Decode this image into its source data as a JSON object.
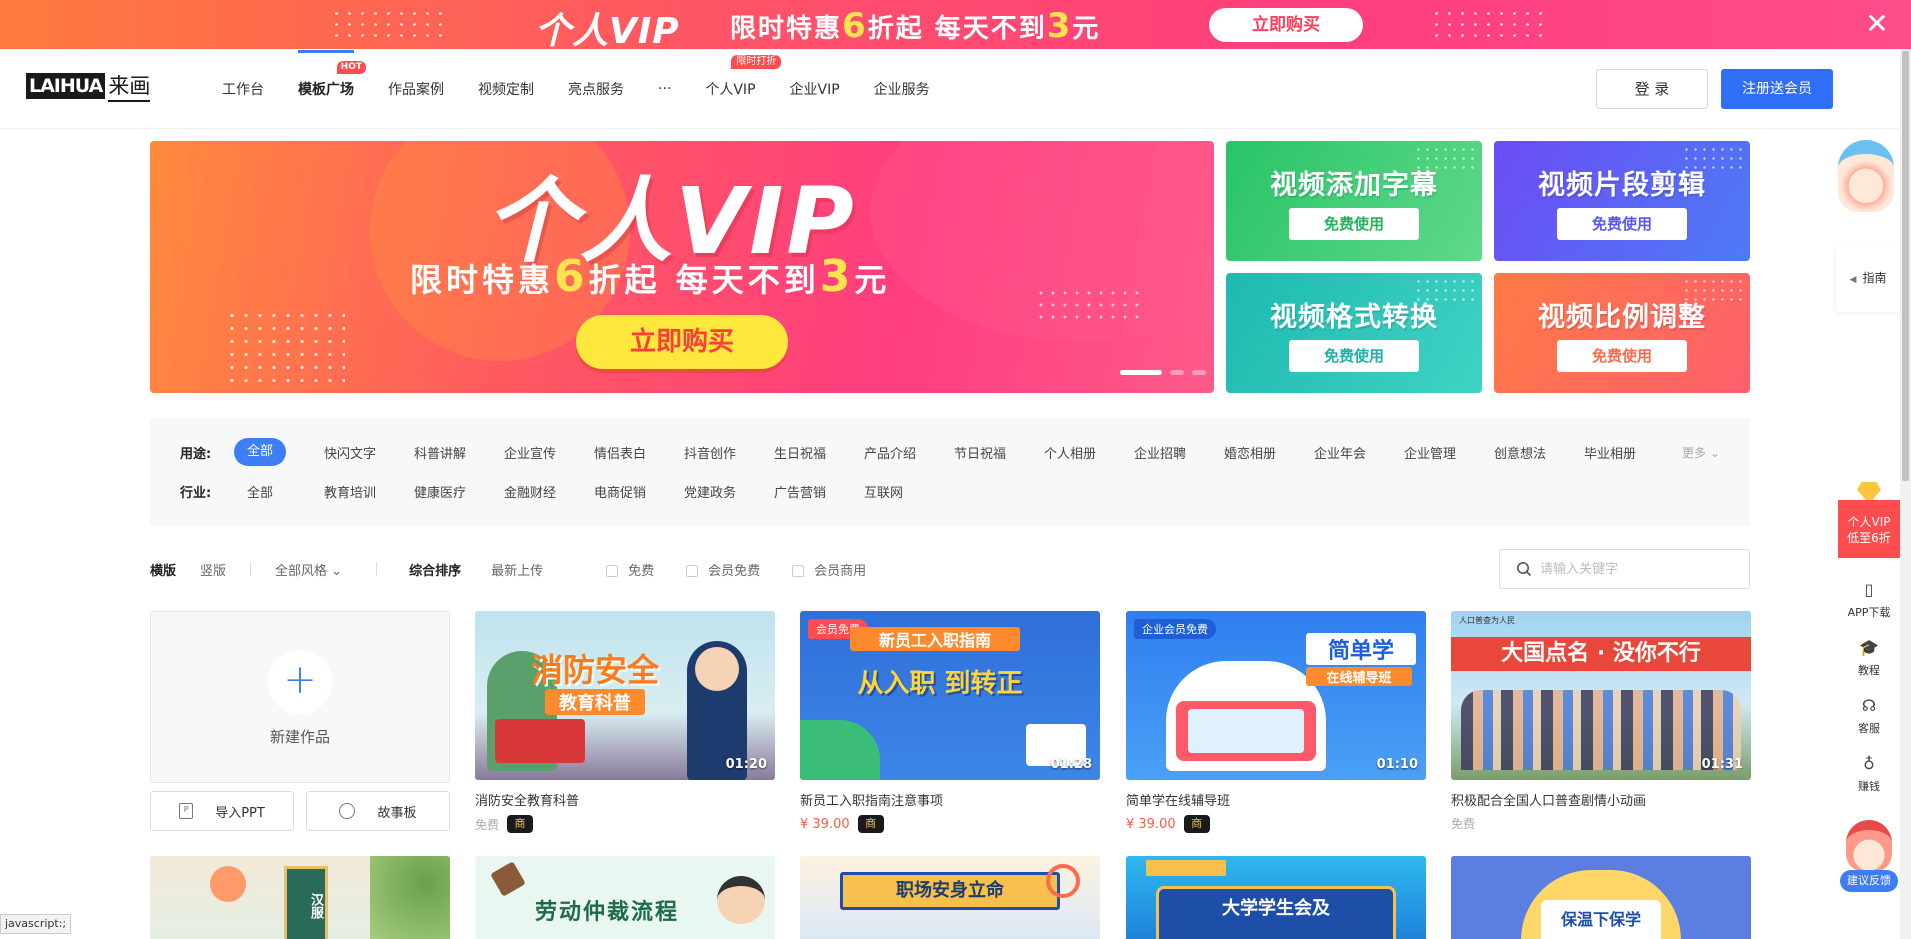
{
  "promo": {
    "title": "个人VIP",
    "sub_pre": "限时特惠",
    "sub_n1": "6",
    "sub_mid": "折起  每天不到",
    "sub_n2": "3",
    "sub_post": "元",
    "buy": "立即购买",
    "close": "✕"
  },
  "header": {
    "logo_en": "LAIHUA",
    "logo_cn": "来画",
    "nav": [
      "工作台",
      "模板广场",
      "作品案例",
      "视频定制",
      "亮点服务",
      "···",
      "个人VIP",
      "企业VIP",
      "企业服务"
    ],
    "hot_tag": "HOT",
    "sale_tag": "限时打折",
    "login": "登 录",
    "register": "注册送会员"
  },
  "banner": {
    "big": "个人VIP",
    "line_pre": "限时特惠",
    "n1": "6",
    "line_mid": "折起  每天不到",
    "n2": "3",
    "line_post": "元",
    "cta": "立即购买"
  },
  "tools": [
    {
      "title": "视频添加字幕",
      "btn": "免费使用"
    },
    {
      "title": "视频片段剪辑",
      "btn": "免费使用"
    },
    {
      "title": "视频格式转换",
      "btn": "免费使用"
    },
    {
      "title": "视频比例调整",
      "btn": "免费使用"
    }
  ],
  "filters": {
    "use_label": "用途:",
    "use": [
      "全部",
      "快闪文字",
      "科普讲解",
      "企业宣传",
      "情侣表白",
      "抖音创作",
      "生日祝福",
      "产品介绍",
      "节日祝福",
      "个人相册",
      "企业招聘",
      "婚恋相册",
      "企业年会",
      "企业管理",
      "创意想法",
      "毕业相册"
    ],
    "more": "更多 ⌄",
    "industry_label": "行业:",
    "industry": [
      "全部",
      "教育培训",
      "健康医疗",
      "金融财经",
      "电商促销",
      "党建政务",
      "广告营销",
      "互联网"
    ]
  },
  "sortbar": {
    "orient": [
      "横版",
      "竖版"
    ],
    "style": "全部风格 ⌄",
    "sort": [
      "综合排序",
      "最新上传"
    ],
    "checks": [
      "免费",
      "会员免费",
      "会员商用"
    ],
    "search_placeholder": "请输入关键字"
  },
  "grid": {
    "new_label": "新建作品",
    "import_ppt": "导入PPT",
    "storyboard": "故事板",
    "cards": [
      {
        "name": "消防安全教育科普",
        "duration": "01:20",
        "price": "免费",
        "shang": true,
        "thumb_title": "消防安全",
        "thumb_sub": "教育科普",
        "badge": ""
      },
      {
        "name": "新员工入职指南注意事项",
        "duration": "01:28",
        "price": "¥ 39.00",
        "shang": true,
        "thumb_title": "新员工入职指南",
        "thumb_sub": "从入职 到转正",
        "badge": "会员免费"
      },
      {
        "name": "简单学在线辅导班",
        "duration": "01:10",
        "price": "¥ 39.00",
        "shang": true,
        "thumb_title": "简单学",
        "thumb_sub": "在线辅导班",
        "badge": "企业会员免费"
      },
      {
        "name": "积极配合全国人口普查剧情小动画",
        "duration": "01:31",
        "price": "免费",
        "shang": false,
        "thumb_title": "大国点名 · 没你不行",
        "thumb_sub": "人口普查为人民",
        "badge": ""
      }
    ],
    "shang_label": "商",
    "row2_titles": [
      "汉服",
      "劳动仲裁流程",
      "职场安身立命",
      "大学学生会及",
      "保温下保学"
    ]
  },
  "side": {
    "guide": "指南",
    "vip": "个人VIP\n低至6折",
    "vip_l1": "个人VIP",
    "vip_l2": "低至6折",
    "dock": [
      {
        "icon": "▯",
        "label": "APP下载"
      },
      {
        "icon": "🎓",
        "label": "教程"
      },
      {
        "icon": "☊",
        "label": "客服"
      },
      {
        "icon": "♁",
        "label": "赚钱"
      }
    ],
    "feedback": "建议反馈"
  },
  "status": "javascript:;"
}
